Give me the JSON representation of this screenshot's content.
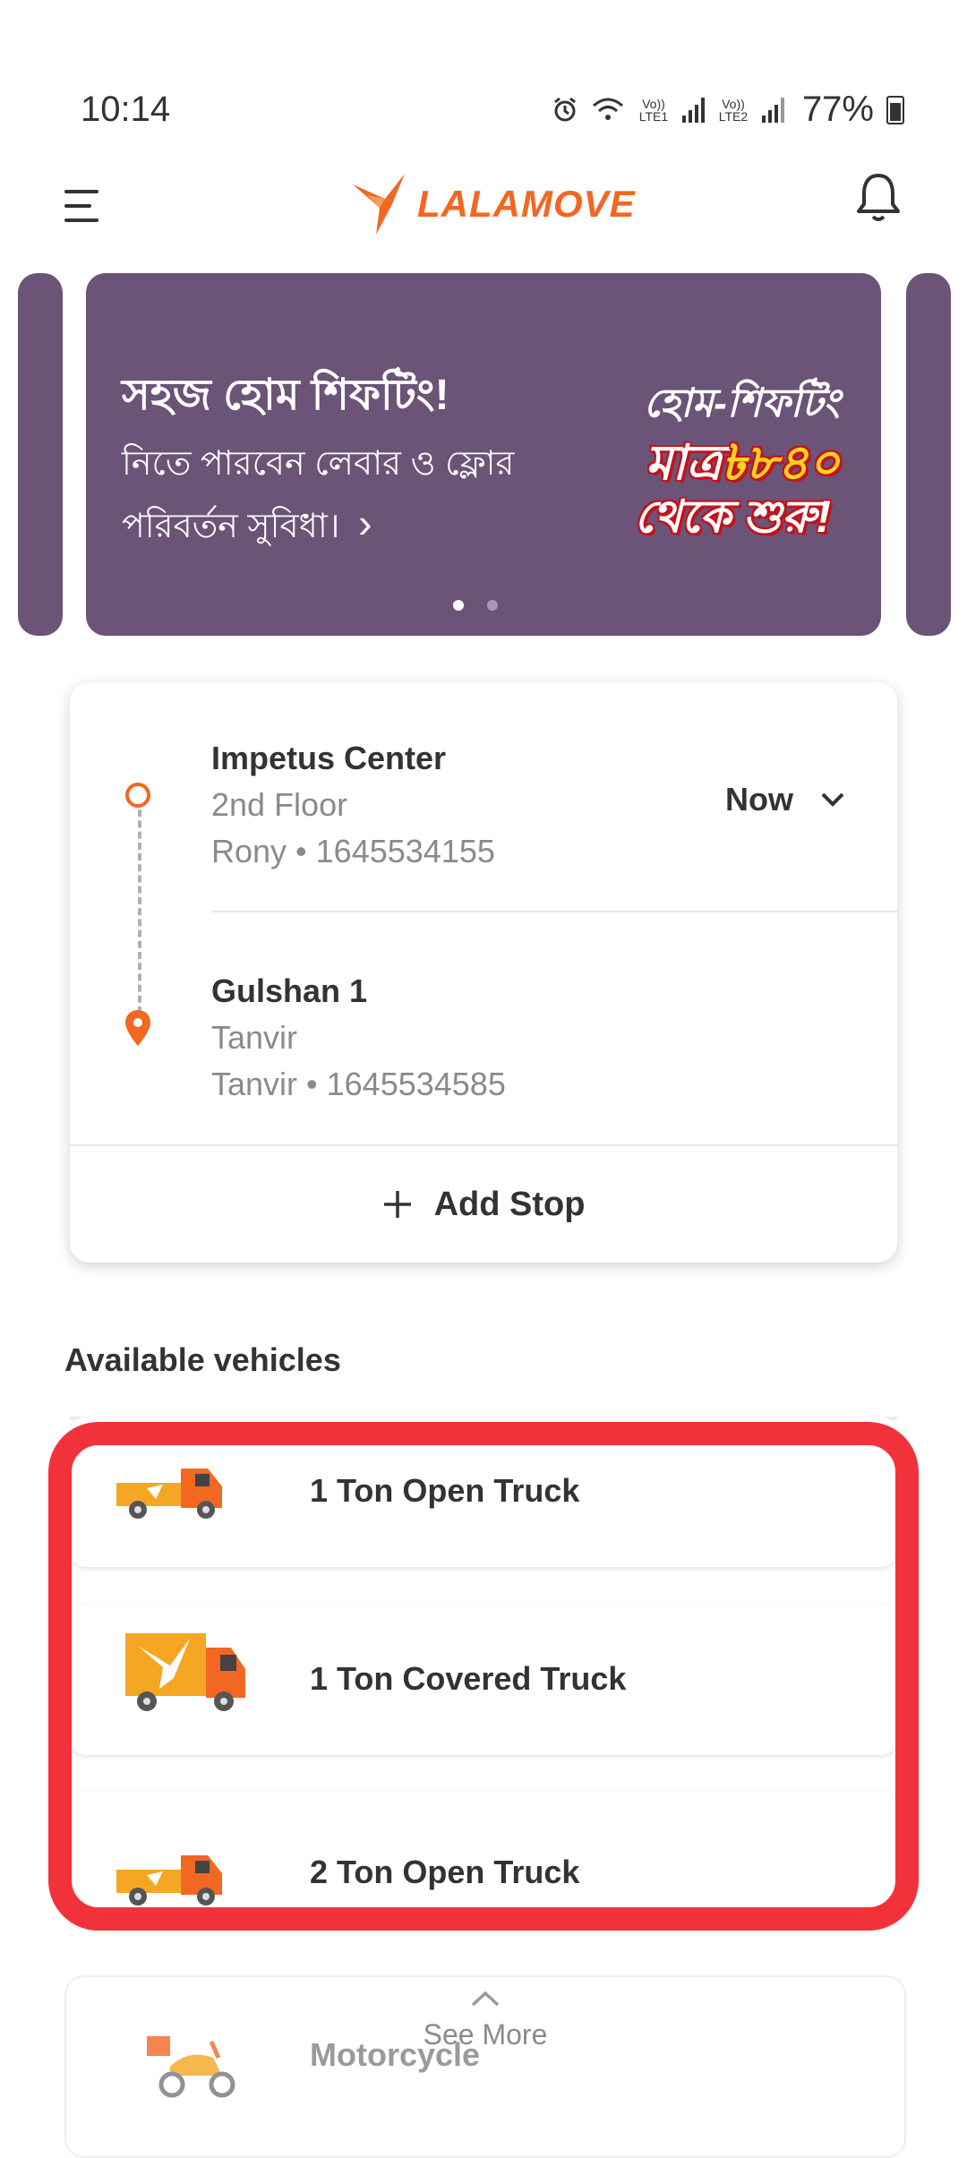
{
  "status_bar": {
    "time": "10:14",
    "sim1_label": "Vo)) LTE1",
    "sim2_label": "Vo)) LTE2",
    "battery": "77%"
  },
  "header": {
    "logo_text": "LALAMOVE",
    "brand_color": "#f26722"
  },
  "banner": {
    "title": "সহজ হোম শিফটিং!",
    "subtitle": "নিতে পারবেন লেবার ও ফ্লোর পরিবর্তন সুবিধা।",
    "arrow": "›",
    "promo_line1": "হোম-শিফটিং",
    "promo_line2_prefix": "মাত্র",
    "promo_line2_price": "৳৮৪০",
    "promo_line3": "থেকে শুরু!",
    "background_color": "#6b5477",
    "active_dot": 1,
    "dot_count": 2
  },
  "route": {
    "pickup": {
      "name": "Impetus Center",
      "detail": "2nd Floor",
      "contact": "Rony • 1645534155"
    },
    "dropoff": {
      "name": "Gulshan 1",
      "detail": "Tanvir",
      "contact": "Tanvir • 1645534585"
    },
    "time_label": "Now",
    "add_stop_label": "Add Stop"
  },
  "vehicles": {
    "section_title": "Available vehicles",
    "items": [
      {
        "name": "1 Ton Open Truck",
        "icon": "open-truck-icon"
      },
      {
        "name": "1 Ton Covered Truck",
        "icon": "covered-truck-icon"
      },
      {
        "name": "2 Ton Open Truck",
        "icon": "open-truck-icon"
      }
    ],
    "next_item": "Motorcycle",
    "see_more_label": "See More",
    "highlight_color": "#f2323a"
  }
}
